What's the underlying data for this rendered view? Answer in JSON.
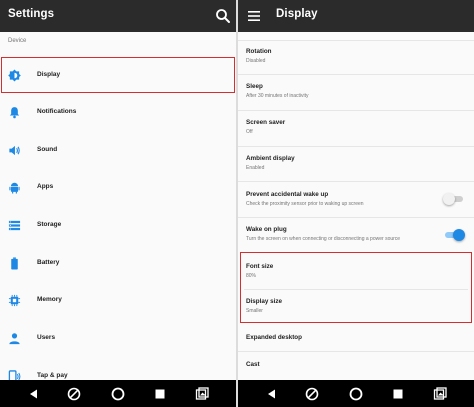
{
  "colors": {
    "toolbar": "#2b2b2b",
    "accent": "#1e88e5",
    "highlight": "#d32f2f",
    "navbar": "#000000"
  },
  "settings_screen": {
    "title": "Settings",
    "toolbar_icon": "search-icon",
    "section_label": "Device",
    "items": [
      {
        "label": "Display",
        "icon": "display-brightness-icon",
        "highlighted": true
      },
      {
        "label": "Notifications",
        "icon": "bell-icon"
      },
      {
        "label": "Sound",
        "icon": "volume-icon"
      },
      {
        "label": "Apps",
        "icon": "android-icon"
      },
      {
        "label": "Storage",
        "icon": "storage-icon"
      },
      {
        "label": "Battery",
        "icon": "battery-icon"
      },
      {
        "label": "Memory",
        "icon": "memory-icon"
      },
      {
        "label": "Users",
        "icon": "user-icon"
      },
      {
        "label": "Tap & pay",
        "icon": "tap-pay-icon"
      }
    ]
  },
  "display_screen": {
    "title": "Display",
    "toolbar_icon": "menu-icon",
    "items": [
      {
        "title": "Rotation",
        "summary": "Disabled"
      },
      {
        "title": "Sleep",
        "summary": "After 30 minutes of inactivity"
      },
      {
        "title": "Screen saver",
        "summary": "Off"
      },
      {
        "title": "Ambient display",
        "summary": "Enabled"
      },
      {
        "title": "Prevent accidental wake up",
        "summary": "Check the proximity sensor prior to waking up screen",
        "toggle": false
      },
      {
        "title": "Wake on plug",
        "summary": "Turn the screen on when connecting or disconnecting a power source",
        "toggle": true
      },
      {
        "title": "Font size",
        "summary": "80%",
        "highlighted": true
      },
      {
        "title": "Display size",
        "summary": "Smaller",
        "highlighted": true
      },
      {
        "title": "Expanded desktop"
      },
      {
        "title": "Cast"
      }
    ]
  },
  "nav_bar": {
    "buttons": [
      "back-icon",
      "no-disturb-icon",
      "home-icon",
      "recents-icon",
      "screenshot-icon"
    ]
  }
}
